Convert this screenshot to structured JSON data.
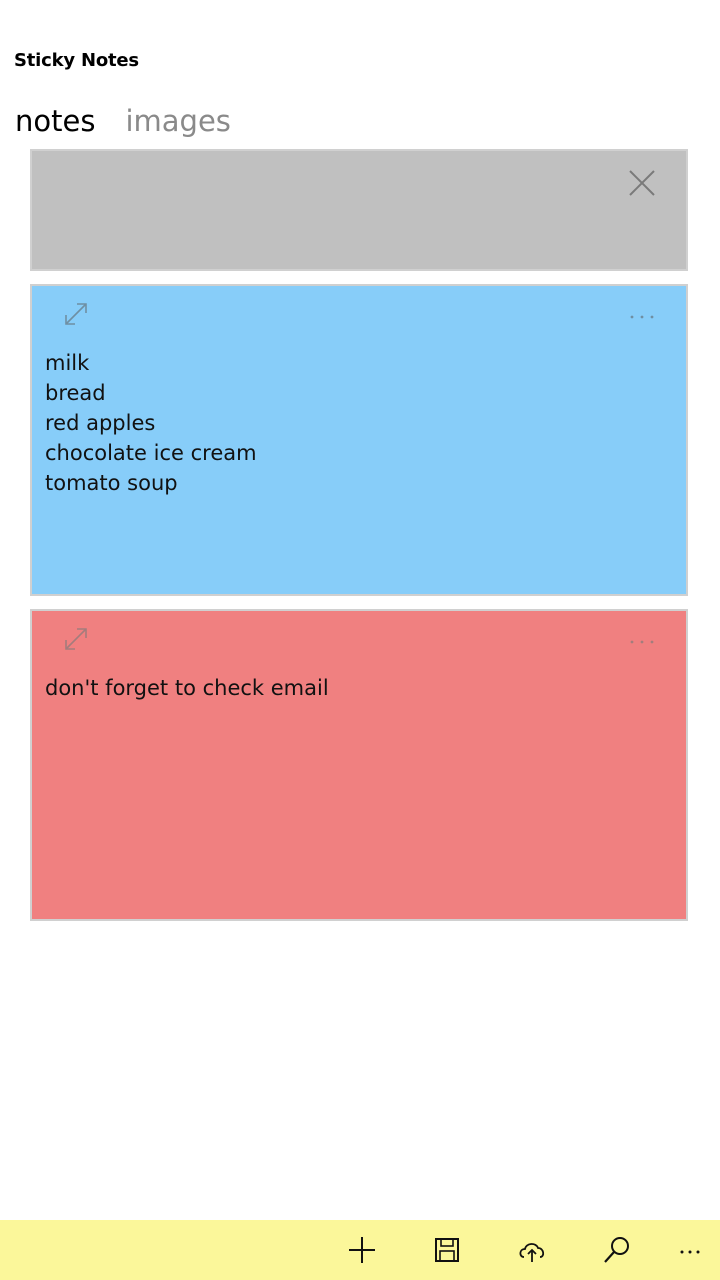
{
  "app": {
    "title": "Sticky Notes"
  },
  "tabs": [
    {
      "label": "notes",
      "active": true
    },
    {
      "label": "images",
      "active": false
    }
  ],
  "notes": [
    {
      "color": "#c0c0c0",
      "text": "",
      "kind": "new-note"
    },
    {
      "color": "#87cdf9",
      "text": "milk\nbread\nred apples\nchocolate ice cream\ntomato soup"
    },
    {
      "color": "#f08080",
      "text": "don't forget to check email"
    }
  ],
  "app_bar": {
    "background": "#fbf79a",
    "buttons": [
      {
        "icon": "add-icon"
      },
      {
        "icon": "save-icon"
      },
      {
        "icon": "cloud-upload-icon"
      },
      {
        "icon": "search-icon"
      },
      {
        "icon": "more-icon"
      }
    ]
  }
}
